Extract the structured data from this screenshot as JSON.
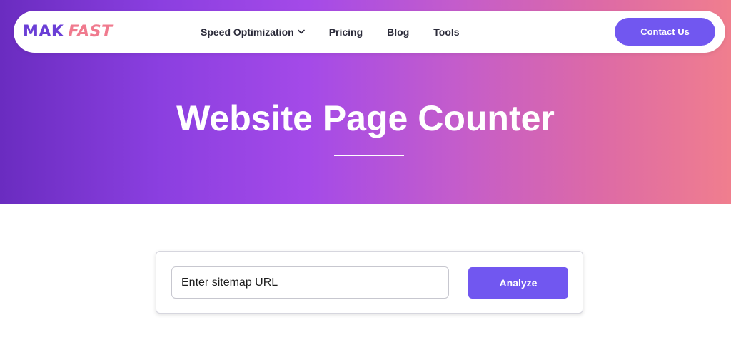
{
  "brand": {
    "logo_part1": "MAK",
    "logo_part2": "FAST",
    "colors": {
      "primary": "#7157f0",
      "logo_purple": "#6b3fd6",
      "logo_pink": "#f07a8e"
    }
  },
  "nav": {
    "items": [
      {
        "label": "Speed Optimization",
        "has_dropdown": true,
        "icon": "chevron-down-icon"
      },
      {
        "label": "Pricing"
      },
      {
        "label": "Blog"
      },
      {
        "label": "Tools"
      }
    ],
    "contact_label": "Contact Us"
  },
  "hero": {
    "title": "Website Page Counter"
  },
  "tool": {
    "input_placeholder": "Enter sitemap URL",
    "input_value": "",
    "analyze_label": "Analyze"
  }
}
